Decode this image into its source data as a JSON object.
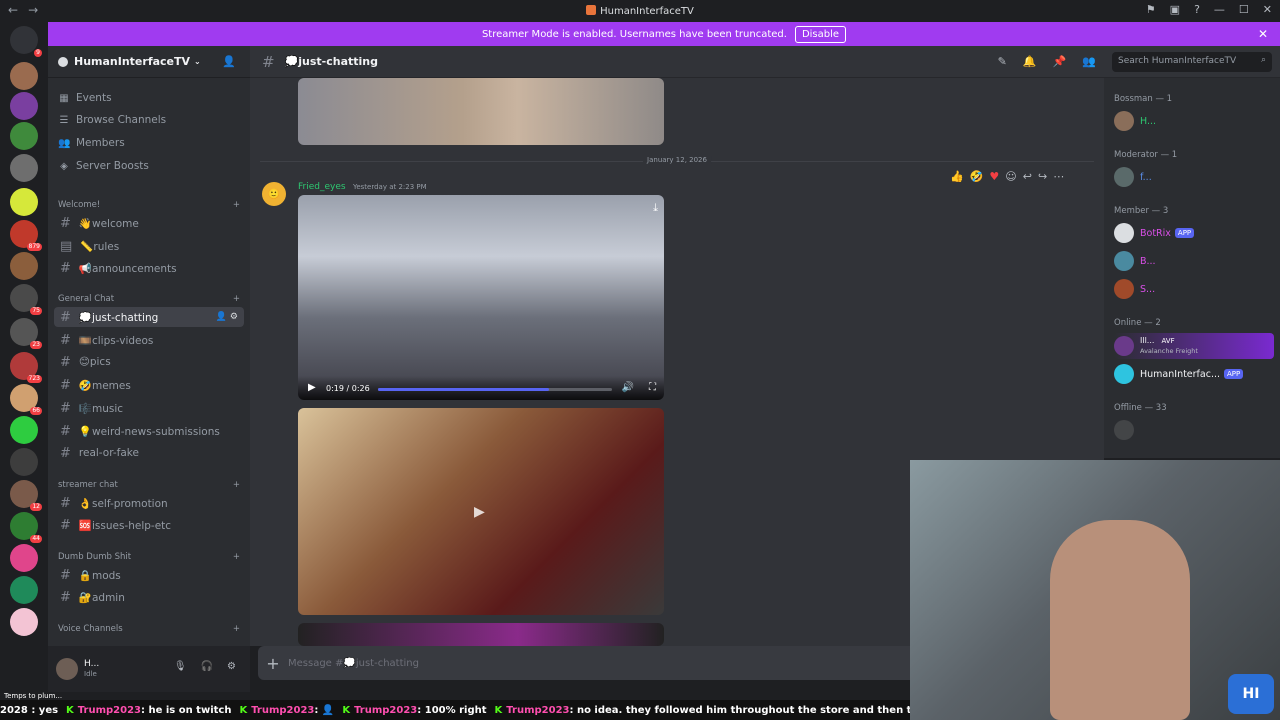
{
  "window": {
    "title": "HumanInterfaceTV"
  },
  "banner": {
    "text": "Streamer Mode is enabled. Usernames have been truncated.",
    "button": "Disable"
  },
  "server": {
    "name": "HumanInterfaceTV"
  },
  "nav": [
    {
      "label": "Events",
      "icon": "calendar-icon"
    },
    {
      "label": "Browse Channels",
      "icon": "browse-icon"
    },
    {
      "label": "Members",
      "icon": "members-icon"
    },
    {
      "label": "Server Boosts",
      "icon": "boost-icon"
    }
  ],
  "categories": {
    "welcome": "Welcome!",
    "general": "General Chat",
    "streamer": "streamer chat",
    "dumb": "Dumb Dumb Shit",
    "voice": "Voice Channels"
  },
  "channels": {
    "welcome": "👋welcome",
    "rules": "📏rules",
    "announcements": "📢announcements",
    "just_chatting": "💭just-chatting",
    "clips": "🎞️clips-videos",
    "pics": "😊pics",
    "memes": "🤣memes",
    "music": "🎼music",
    "weird": "💡weird-news-submissions",
    "real": "real-or-fake",
    "self": "👌self-promotion",
    "issues": "🆘issues-help-etc",
    "mods": "🔒mods",
    "admin": "🔐admin"
  },
  "user": {
    "name": "H...",
    "status": "Idle"
  },
  "header": {
    "channel": "💭just-chatting",
    "search_placeholder": "Search HumanInterfaceTV"
  },
  "chat": {
    "date": "January 12, 2026",
    "author": "Fried_eyes",
    "timestamp": "Yesterday at 2:23 PM",
    "video_time": "0:19 / 0:26",
    "video_progress": 0.73,
    "composer_placeholder": "Message #💭just-chatting"
  },
  "members": {
    "bossman_header": "Bossman — 1",
    "bossman_1": "H...",
    "moderator_header": "Moderator — 1",
    "moderator_1": "f...",
    "member_header": "Member — 3",
    "member_1": "BotRix",
    "member_1_tag": "APP",
    "member_2": "B...",
    "member_3": "S...",
    "online_header": "Online — 2",
    "online_1": "Ill...",
    "online_1_activity": "Avalanche Freight",
    "online_1_badge": "AVF",
    "online_2": "HumanInterfac...",
    "online_2_tag": "APP",
    "offline_header": "Offline — 33"
  },
  "ticker": {
    "popup": "Temps to plum...",
    "lead": "2028 : yes",
    "items": [
      {
        "user": "Trump2023",
        "text": " : he is on twitch"
      },
      {
        "user": "Trump2023",
        "text": " : 👤"
      },
      {
        "user": "Trump2023",
        "text": " : 100% right"
      },
      {
        "user": "Trump2023",
        "text": " : no idea. they followed him throughout the store and then this was the"
      }
    ]
  },
  "colors": {
    "accent": "#5865f2",
    "banner": "#a03bf0",
    "author": "#2dc770",
    "ticker_user": "#ff4fb0"
  }
}
